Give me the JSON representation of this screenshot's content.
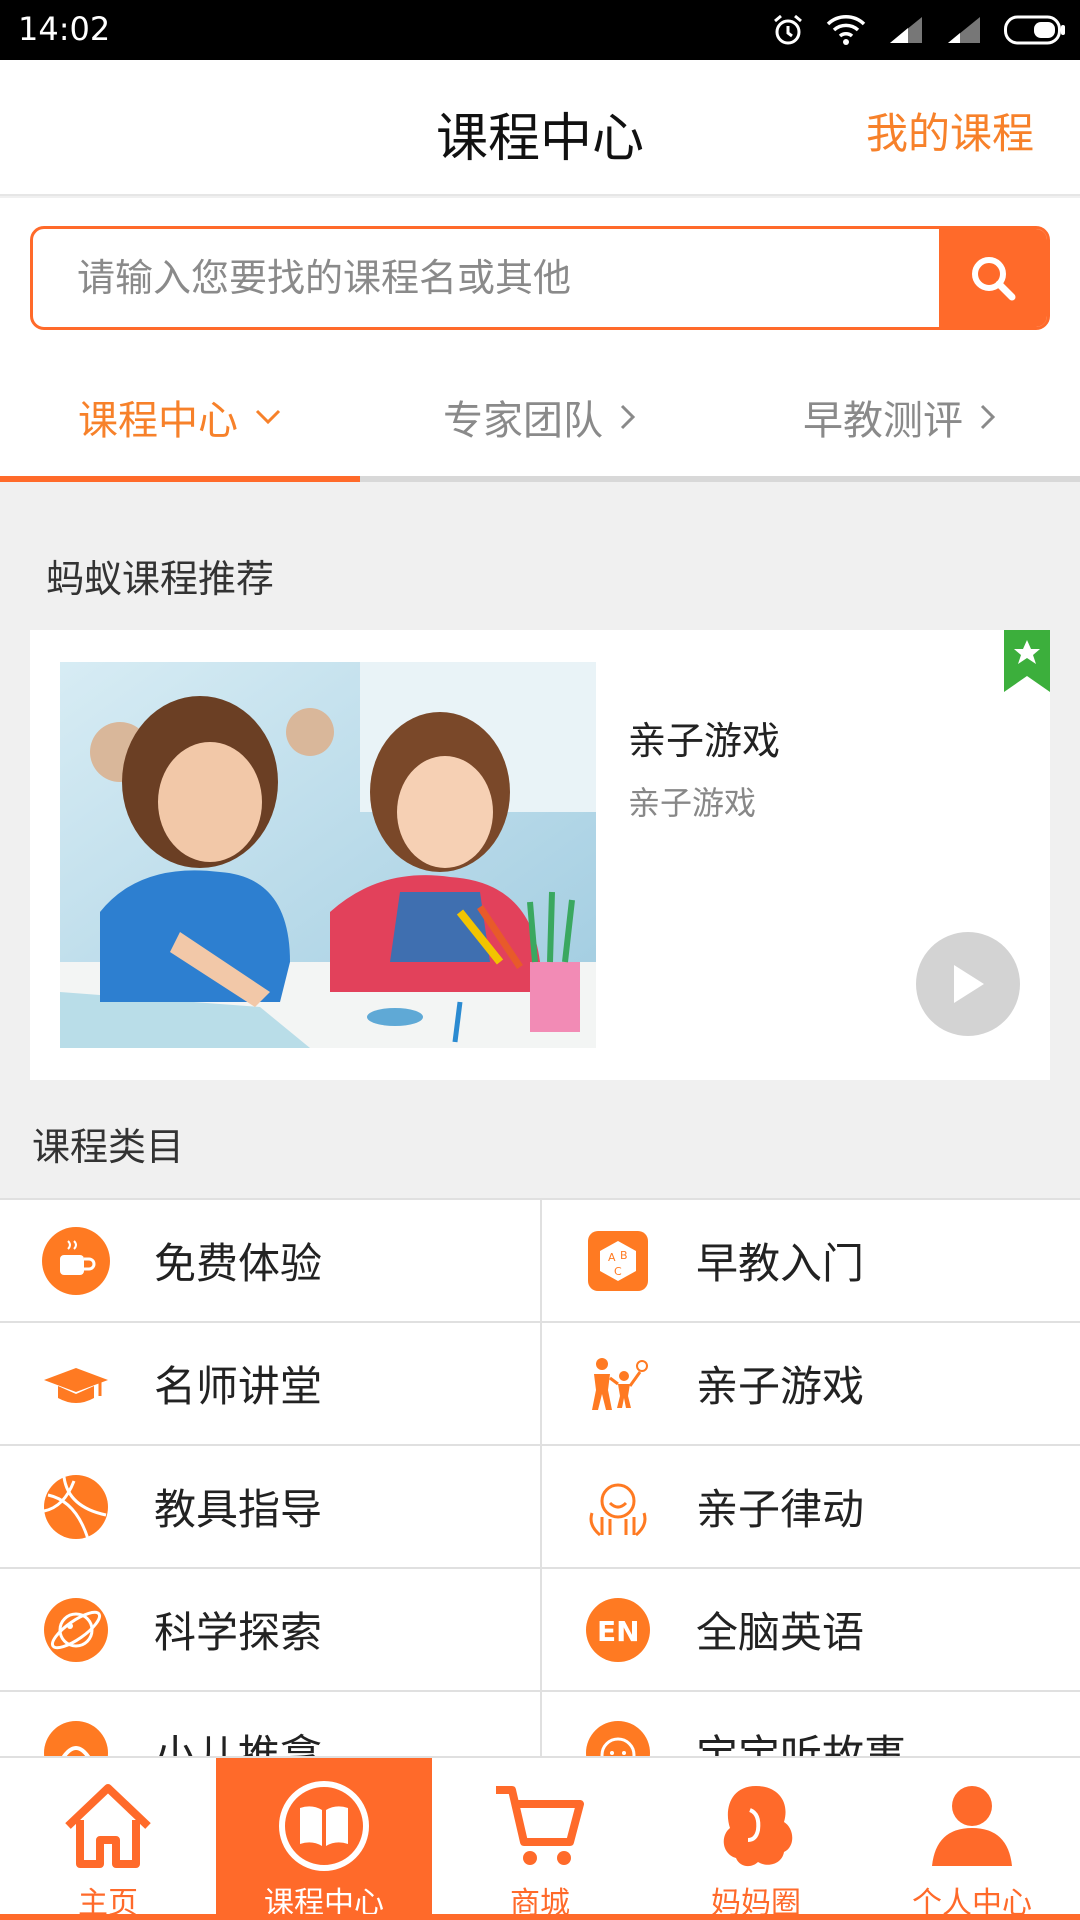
{
  "status_bar": {
    "time": "14:02"
  },
  "header": {
    "title": "课程中心",
    "my_courses": "我的课程"
  },
  "search": {
    "placeholder": "请输入您要找的课程名或其他"
  },
  "tabs": [
    {
      "label": "课程中心",
      "active": true
    },
    {
      "label": "专家团队",
      "active": false
    },
    {
      "label": "早教测评",
      "active": false
    }
  ],
  "recommend": {
    "section_title": "蚂蚁课程推荐",
    "card": {
      "title": "亲子游戏",
      "subtitle": "亲子游戏"
    }
  },
  "categories": {
    "section_title": "课程类目",
    "items": [
      {
        "label": "免费体验",
        "icon": "cup-icon"
      },
      {
        "label": "早教入门",
        "icon": "abc-block-icon"
      },
      {
        "label": "名师讲堂",
        "icon": "graduation-cap-icon"
      },
      {
        "label": "亲子游戏",
        "icon": "parent-child-icon"
      },
      {
        "label": "教具指导",
        "icon": "ball-icon"
      },
      {
        "label": "亲子律动",
        "icon": "dance-icon"
      },
      {
        "label": "科学探索",
        "icon": "planet-icon"
      },
      {
        "label": "全脑英语",
        "icon": "en-icon"
      },
      {
        "label": "小儿推拿",
        "icon": "massage-icon"
      },
      {
        "label": "宝宝听故事",
        "icon": "story-icon"
      }
    ]
  },
  "bottom_nav": [
    {
      "label": "主页",
      "icon": "home-icon",
      "active": false
    },
    {
      "label": "课程中心",
      "icon": "book-icon",
      "active": true
    },
    {
      "label": "商城",
      "icon": "cart-icon",
      "active": false
    },
    {
      "label": "妈妈圈",
      "icon": "mom-icon",
      "active": false
    },
    {
      "label": "个人中心",
      "icon": "person-icon",
      "active": false
    }
  ],
  "colors": {
    "accent": "#ff6a2a",
    "accent_text": "#f7812a",
    "background": "#f0f0f0"
  }
}
